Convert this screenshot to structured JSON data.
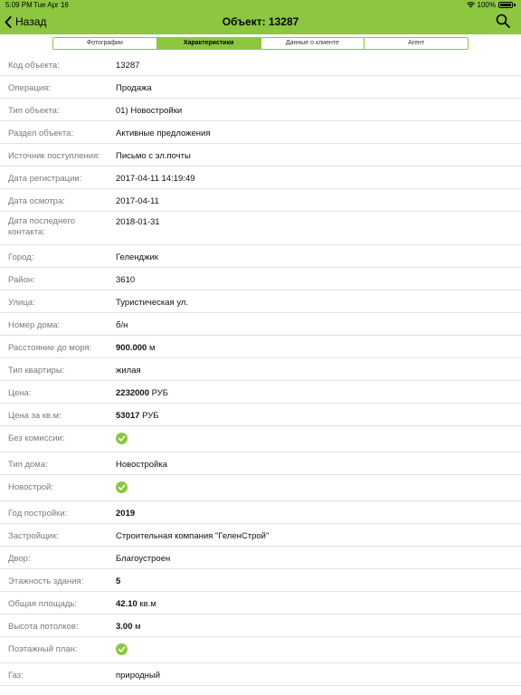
{
  "status": {
    "time": "5:09 PM",
    "date": "Tue Apr 16",
    "battery": "100%"
  },
  "nav": {
    "back_label": "Назад",
    "title": "Объект: 13287"
  },
  "tabs": [
    {
      "label": "Фотографии",
      "active": false
    },
    {
      "label": "Характеристики",
      "active": true
    },
    {
      "label": "Данные о клиенте",
      "active": false
    },
    {
      "label": "Агент",
      "active": false
    }
  ],
  "fields": [
    {
      "label": "Код объекта:",
      "value": "13287"
    },
    {
      "label": "Операция:",
      "value": "Продажа"
    },
    {
      "label": "Тип объекта:",
      "value": "01) Новостройки"
    },
    {
      "label": "Раздел объекта:",
      "value": "Активные предложения"
    },
    {
      "label": "Источник поступления:",
      "value": "Письмо с эл.почты"
    },
    {
      "label": "Дата регистрации:",
      "value": "2017-04-11 14:19:49"
    },
    {
      "label": "Дата осмотра:",
      "value": "2017-04-11"
    },
    {
      "label": "Дата последнего контакта:",
      "value": "2018-01-31"
    },
    {
      "label": "Город:",
      "value": "Геленджик"
    },
    {
      "label": "Район:",
      "value": "3610"
    },
    {
      "label": "Улица:",
      "value": "Туристическая ул."
    },
    {
      "label": "Номер дома:",
      "value": "б/н"
    },
    {
      "label": "Расстояние до моря:",
      "value_bold": "900.000",
      "unit": "м"
    },
    {
      "label": "Тип квартиры:",
      "value": "жилая"
    },
    {
      "label": "Цена:",
      "value_bold": "2232000",
      "unit": "РУБ"
    },
    {
      "label": "Цена за кв.м:",
      "value_bold": "53017",
      "unit": "РУБ"
    },
    {
      "label": "Без комиссии:",
      "check": true
    },
    {
      "label": "Тип дома:",
      "value": "Новостройка"
    },
    {
      "label": "Новострой:",
      "check": true
    },
    {
      "label": "Год постройки:",
      "value_bold": "2019"
    },
    {
      "label": "Застройщик:",
      "value": "Строительная компания \"ГеленСтрой\""
    },
    {
      "label": "Двор:",
      "value": "Благоустроен"
    },
    {
      "label": "Этажность здания:",
      "value_bold": "5"
    },
    {
      "label": "Общая площадь:",
      "value_bold": "42.10",
      "unit": "кв.м"
    },
    {
      "label": "Высота потолков:",
      "value_bold": "3.00",
      "unit": "м"
    },
    {
      "label": "Поэтажный план:",
      "check": true
    },
    {
      "label": "Газ:",
      "value": "природный"
    }
  ],
  "colors": {
    "accent": "#8dc63f",
    "check": "#8dc63f",
    "label": "#7a7a7a"
  }
}
